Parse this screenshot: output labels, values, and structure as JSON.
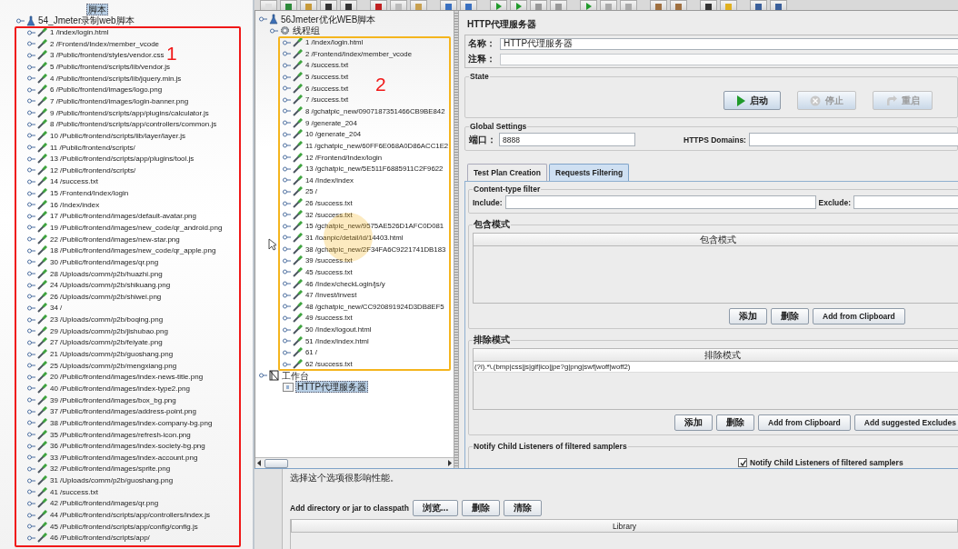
{
  "left_tree": {
    "top_label": "脚本",
    "root": "54_Jmeter录制web脚本",
    "annotation": "1",
    "items": [
      "1 /index/login.html",
      "2 /Frontend/Index/member_vcode",
      "3 /Public/frontend/styles/vendor.css",
      "5 /Public/frontend/scripts/lib/vendor.js",
      "4 /Public/frontend/scripts/lib/jquery.min.js",
      "6 /Public/frontend/images/logo.png",
      "7 /Public/frontend/images/login-banner.png",
      "9 /Public/frontend/scripts/app/plugins/calculator.js",
      "8 /Public/frontend/scripts/app/controllers/common.js",
      "10 /Public/frontend/scripts/lib/layer/layer.js",
      "11 /Public/frontend/scripts/",
      "13 /Public/frontend/scripts/app/plugins/tool.js",
      "12 /Public/frontend/scripts/",
      "14 /success.txt",
      "15 /Frontend/Index/login",
      "16 /Index/index",
      "17 /Public/frontend/images/default-avatar.png",
      "19 /Public/frontend/images/new_code/qr_android.png",
      "22 /Public/frontend/images/new-star.png",
      "18 /Public/frontend/images/new_code/qr_apple.png",
      "30 /Public/frontend/images/qr.png",
      "28 /Uploads/comm/p2b/huazhi.png",
      "24 /Uploads/comm/p2b/shikuang.png",
      "26 /Uploads/comm/p2b/shiwei.png",
      "34 /",
      "23 /Uploads/comm/p2b/boqing.png",
      "29 /Uploads/comm/p2b/jishubao.png",
      "27 /Uploads/comm/p2b/feiyate.png",
      "21 /Uploads/comm/p2b/guoshang.png",
      "25 /Uploads/comm/p2b/mengxiang.png",
      "20 /Public/frontend/images/index-news-title.png",
      "40 /Public/frontend/images/index-type2.png",
      "39 /Public/frontend/images/box_bg.png",
      "37 /Public/frontend/images/address-point.png",
      "38 /Public/frontend/images/index-company-bg.png",
      "35 /Public/frontend/images/refresh-icon.png",
      "36 /Public/frontend/images/index-society-bg.png",
      "33 /Public/frontend/images/index-account.png",
      "32 /Public/frontend/images/sprite.png",
      "31 /Uploads/comm/p2b/guoshang.png",
      "41 /success.txt",
      "42 /Public/frontend/images/qr.png",
      "44 /Public/frontend/scripts/app/controllers/index.js",
      "45 /Public/frontend/scripts/app/config/config.js",
      "46 /Public/frontend/scripts/app/"
    ]
  },
  "middle_tree": {
    "plan": "56Jmeter优化WEB脚本",
    "thread_group": "线程组",
    "annotation": "2",
    "items": [
      "1 /Index/login.html",
      "2 /Frontend/Index/member_vcode",
      "4 /success.txt",
      "5 /success.txt",
      "6 /success.txt",
      "7 /success.txt",
      "8 /gchatpic_new/0907187351466CB9BE842",
      "9 /generate_204",
      "10 /generate_204",
      "11 /gchatpic_new/60FF6E068A0D86ACC1E2",
      "12 /Frontend/Index/login",
      "13 /gchatpic_new/5E511F6885911C2F9622",
      "14 /Index/index",
      "25 /",
      "26 /success.txt",
      "32 /success.txt",
      "15 /gchatpic_new/9575AE526D1AFC0D081",
      "31 /loanpic/detail/id/14403.html",
      "38 /gchatpic_new/2F34FA6C9221741DB183",
      "39 /success.txt",
      "45 /success.txt",
      "46 /Index/checkLogin/js/y",
      "47 /Invest/invest",
      "48 /gchatpic_new/CC920891924D3DB8EF5",
      "49 /success.txt",
      "50 /Index/logout.html",
      "51 /Index/index.html",
      "61 /",
      "62 /success.txt"
    ],
    "workbench": "工作台",
    "workbench_children": [
      {
        "label": "HTTP代理服务器",
        "selected": true
      }
    ]
  },
  "proxy_panel": {
    "title": "HTTP代理服务器",
    "name_label": "名称：",
    "name_value": "HTTP代理服务器",
    "comment_label": "注释：",
    "state": {
      "legend": "State",
      "buttons": [
        {
          "label": "启动",
          "disabled": false
        },
        {
          "label": "停止",
          "disabled": true
        },
        {
          "label": "重启",
          "disabled": true
        }
      ]
    },
    "global_settings": {
      "legend": "Global Settings",
      "port_label": "端口：",
      "port_value": "8888",
      "https_label": "HTTPS Domains:"
    },
    "tabs": [
      {
        "label": "Test Plan Creation",
        "selected": false
      },
      {
        "label": "Requests Filtering",
        "selected": true
      }
    ],
    "content_type_filter": {
      "legend": "Content-type filter",
      "include_label": "Include:",
      "exclude_label": "Exclude:"
    },
    "include_patterns": {
      "legend": "包含模式",
      "column": "包含模式",
      "buttons": [
        "添加",
        "删除",
        "Add from Clipboard"
      ]
    },
    "exclude_patterns": {
      "legend": "排除模式",
      "column": "排除模式",
      "rows": [
        "(?i).*\\.(bmp|css|js|gif|ico|jpe?g|png|swf|woff|woff2)"
      ],
      "buttons": [
        "添加",
        "删除",
        "Add from Clipboard",
        "Add suggested Excludes"
      ]
    },
    "notify": {
      "legend": "Notify Child Listeners of filtered samplers",
      "checkbox": {
        "label": "Notify Child Listeners of filtered samplers",
        "checked": true
      }
    }
  },
  "classpath": {
    "note": "选择这个选项很影响性能。",
    "label": "Add directory or jar to classpath",
    "buttons": [
      "浏览...",
      "删除",
      "清除"
    ],
    "column": "Library"
  }
}
